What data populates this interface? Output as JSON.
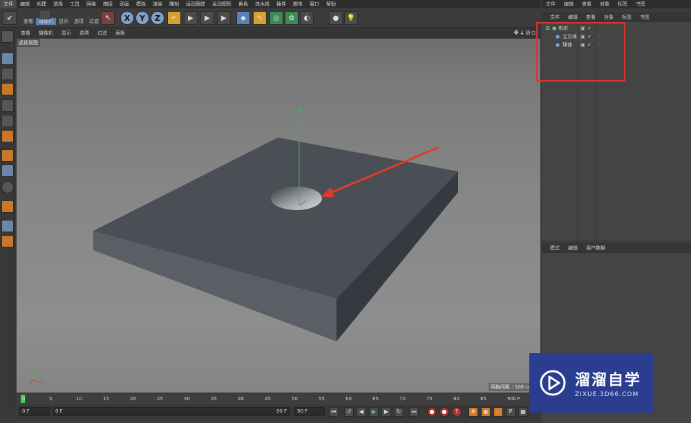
{
  "menu": [
    "文件",
    "编辑",
    "创建",
    "选择",
    "工具",
    "网格",
    "捕捉",
    "动画",
    "模拟",
    "渲染",
    "雕刻",
    "运动跟踪",
    "运动图形",
    "角色",
    "流水线",
    "插件",
    "脚本",
    "窗口",
    "帮助"
  ],
  "toolbar": {
    "x_label": "X",
    "y_label": "Y",
    "z_label": "Z",
    "left_menu": [
      "查看",
      "摄像机",
      "显示",
      "选项",
      "过滤"
    ]
  },
  "viewport": {
    "menu": [
      "查看",
      "摄像机",
      "显示",
      "选项",
      "过滤",
      "面板"
    ],
    "nav_icons": "✥↓⊘▫",
    "label": "透视视图",
    "grid_info": "网格间距 : 100 cm"
  },
  "timeline": {
    "ticks": [
      "0",
      "5",
      "10",
      "15",
      "20",
      "25",
      "30",
      "35",
      "40",
      "45",
      "50",
      "55",
      "60",
      "65",
      "70",
      "75",
      "80",
      "85",
      "90"
    ],
    "end_frame_label": "0 F"
  },
  "controls": {
    "current": "0 F",
    "range_start": "0 F",
    "range_end": "90 F",
    "max": "90 F"
  },
  "object_manager": {
    "menu": [
      "文件",
      "编辑",
      "查看",
      "对象",
      "标签",
      "书签"
    ],
    "tabs": [
      "文件",
      "编辑",
      "查看",
      "对象",
      "标签",
      "书签"
    ],
    "objects": [
      {
        "name": "布尔",
        "indent": 0
      },
      {
        "name": "立方体",
        "indent": 1
      },
      {
        "name": "球体",
        "indent": 1
      }
    ]
  },
  "attributes": {
    "tabs": [
      "模式",
      "编辑",
      "用户数据"
    ]
  },
  "watermark": {
    "name": "溜溜自学",
    "site": "ZIXUE.3D66.COM"
  },
  "colors": {
    "highlight": "#d8362c",
    "arrow": "#e03a2e",
    "watermark_bg": "#2a3d8f"
  }
}
